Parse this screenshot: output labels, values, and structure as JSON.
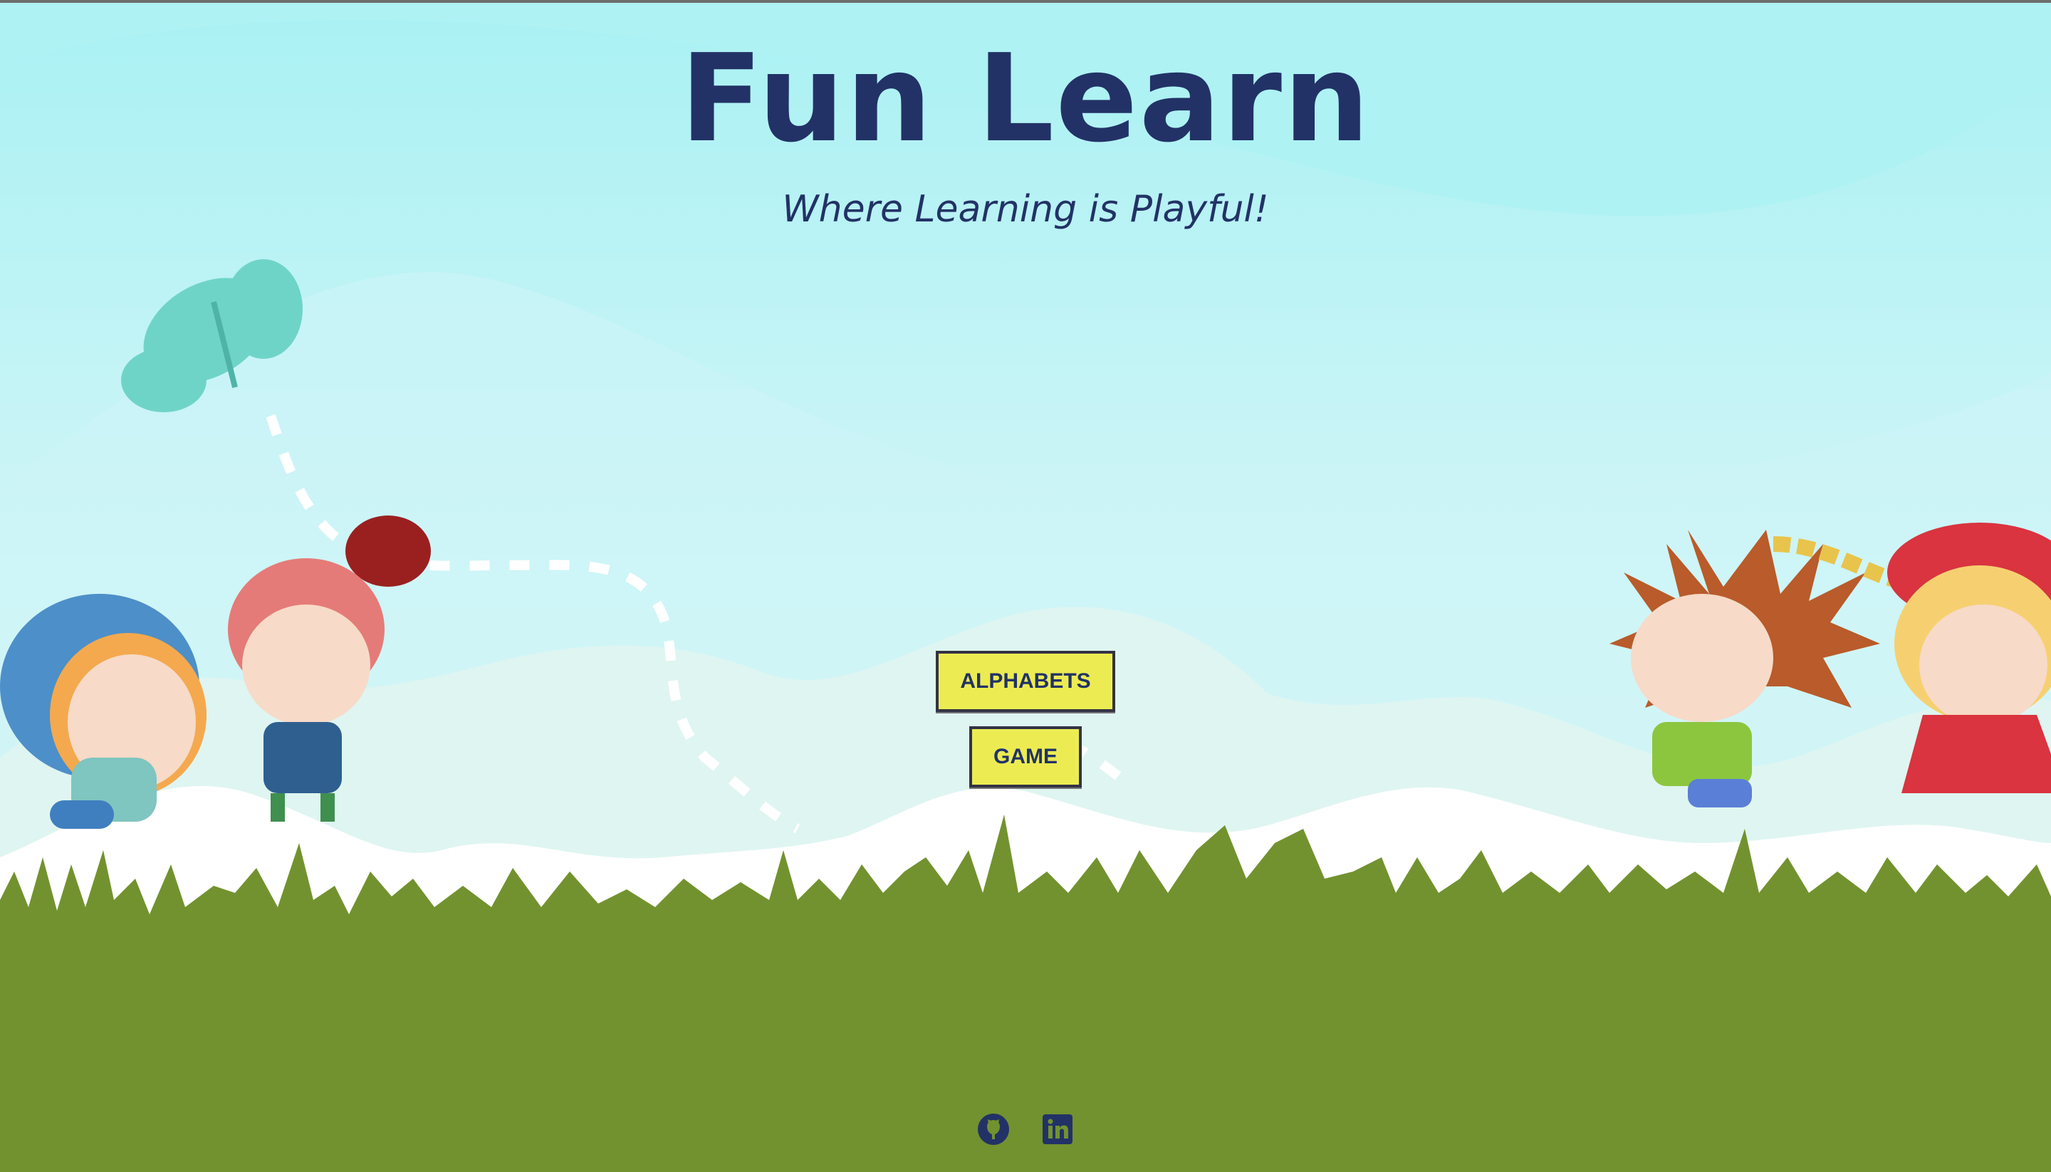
{
  "header": {
    "title": "Fun Learn",
    "subtitle": "Where Learning is Playful!"
  },
  "nav": {
    "alphabets_label": "ALPHABETS",
    "game_label": "GAME"
  },
  "footer": {
    "icons": [
      "github-icon",
      "linkedin-icon"
    ]
  },
  "colors": {
    "sky": "#bff3f5",
    "grass": "#72922f",
    "title": "#223266",
    "button": "#ecec52"
  }
}
